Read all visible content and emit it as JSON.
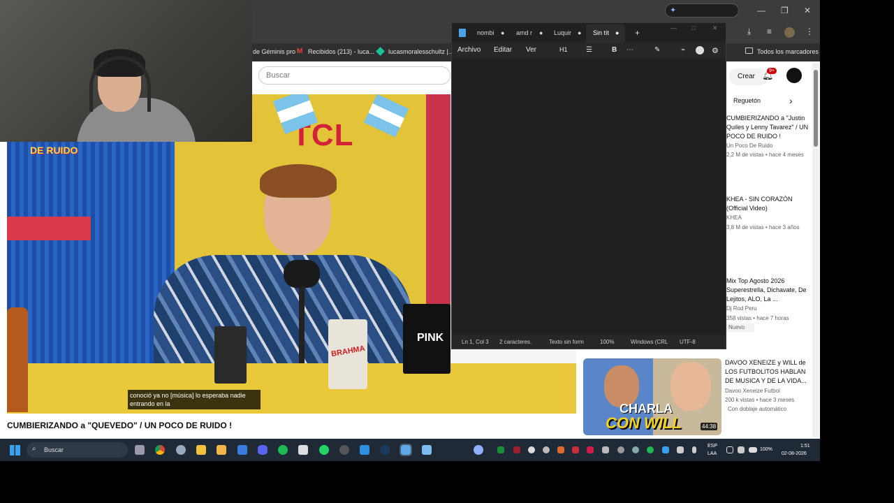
{
  "browser": {
    "bookmarks": [
      {
        "label": "de Géminis pro"
      },
      {
        "label": "Recibidos (213) - luca..."
      },
      {
        "label": "lucasmoralesschultz |..."
      }
    ],
    "all_bookmarks_label": "Todos los marcadores"
  },
  "youtube": {
    "search_placeholder": "Buscar",
    "create_label": "Crear",
    "notif_count": "9+",
    "chip_label": "Reguetón",
    "video_title": "CUMBIERIZANDO a \"QUEVEDO\" / UN POCO DE RUIDO !",
    "caption_line1": "conoció ya no [música] lo esperaba nadie",
    "caption_line2": "entrando en la",
    "logo_text": "DE RUIDO",
    "tcl_text": "TCL",
    "pink_text": "PINK",
    "brahma_text": "BRAHMA",
    "recommendations": [
      {
        "title": "CUMBIERIZANDO a \"Justin Quiles y Lenny Tavarez\" / UN POCO DE RUIDO !",
        "channel": "Un Poco De Ruido",
        "meta": "2,2 M de vistas • hace 4 meses"
      },
      {
        "title": "KHEA - SIN CORAZÓN (Official Video)",
        "channel": "KHEA",
        "meta": "3,8 M de vistas • hace 3 años"
      },
      {
        "title": "Mix Top Agosto 2026 Superestrella, Dichavate, De Lejitos, ALO, La ...",
        "channel": "Dj Rod Peru",
        "meta": "358 vistas • hace 7 horas",
        "badge": "Nuevo"
      },
      {
        "title": "DAVOO XENEIZE y WILL de LOS FUTBOLITOS HABLAN DE MUSICA Y DE LA VIDA...",
        "channel": "Davoo Xeneize Futbol",
        "meta": "200 k vistas • hace 3 meses",
        "extra": "Con doblaje automático",
        "duration": "44:38",
        "thumb_text1": "CHARLA",
        "thumb_text2": "CON WILL"
      }
    ]
  },
  "notepad": {
    "tabs": [
      "nombi",
      "amd r",
      "Luquir",
      "Sin tít"
    ],
    "menu": [
      "Archivo",
      "Editar",
      "Ver"
    ],
    "heading_label": "H1",
    "bold_label": "B",
    "status": {
      "position": "Ln 1, Col 3",
      "chars": "2 caracteres.",
      "format": "Texto sin form",
      "zoom": "100%",
      "eol": "Windows (CRL",
      "encoding": "UTF-8"
    }
  },
  "taskbar": {
    "search_label": "Buscar",
    "lang_top": "ESP",
    "lang_bottom": "LAA",
    "battery": "100%",
    "time": "1:51",
    "date": "02-08-2026"
  }
}
